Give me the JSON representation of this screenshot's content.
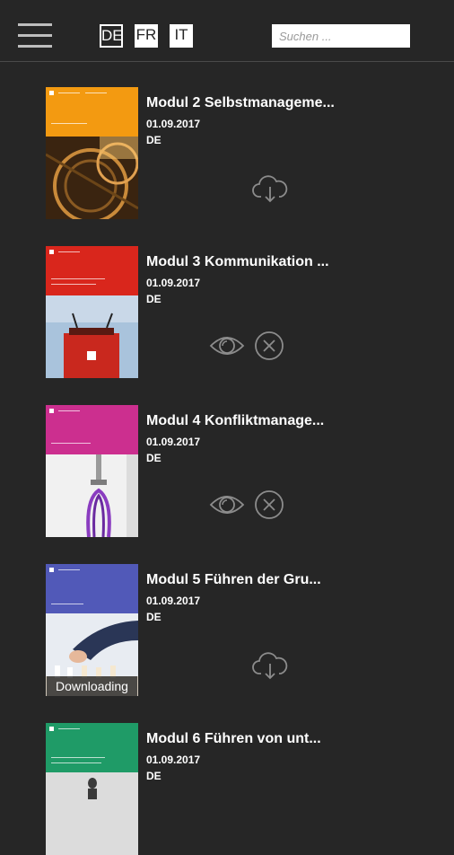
{
  "header": {
    "languages": [
      {
        "code": "DE",
        "active": true
      },
      {
        "code": "FR",
        "active": false
      },
      {
        "code": "IT",
        "active": false
      }
    ],
    "search_placeholder": "Suchen ..."
  },
  "items": [
    {
      "title": "Modul 2 Selbstmanageme...",
      "date": "01.09.2017",
      "lang": "DE",
      "cover_color": "#f39a11",
      "cover_label": "Selbstmanagement",
      "actions": [
        "download"
      ]
    },
    {
      "title": "Modul 3 Kommunikation ...",
      "date": "01.09.2017",
      "lang": "DE",
      "cover_color": "#d9261c",
      "cover_label": "Kommunikation und Präsentation",
      "actions": [
        "view",
        "delete"
      ]
    },
    {
      "title": "Modul 4 Konfliktmanage...",
      "date": "01.09.2017",
      "lang": "DE",
      "cover_color": "#cc2f8f",
      "cover_label": "Konfliktmanagement",
      "actions": [
        "view",
        "delete"
      ]
    },
    {
      "title": "Modul 5 Führen der Gru...",
      "date": "01.09.2017",
      "lang": "DE",
      "cover_color": "#5159b8",
      "cover_label": "Führen der Gruppe",
      "actions": [
        "download"
      ],
      "status": "Downloading"
    },
    {
      "title": "Modul 6 Führen von unt...",
      "date": "01.09.2017",
      "lang": "DE",
      "cover_color": "#1f9b67",
      "cover_label": "Führung von unterstellten Führungspersonen",
      "actions": []
    }
  ],
  "colors": {
    "background": "#262626",
    "icon": "#8c8c8c"
  }
}
